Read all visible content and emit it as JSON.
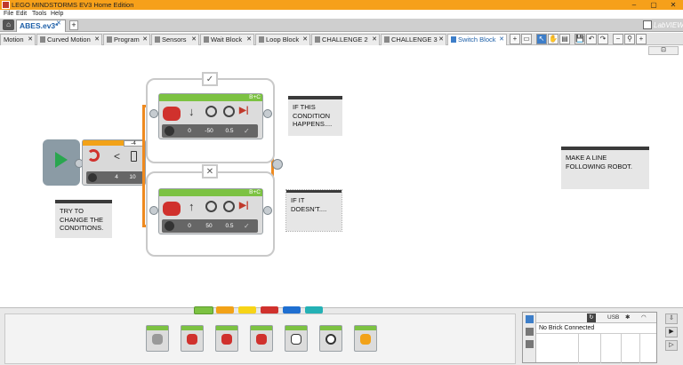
{
  "titlebar": {
    "title": "LEGO MINDSTORMS EV3 Home Edition",
    "minimize": "–",
    "maximize": "▢",
    "close": "✕"
  },
  "menubar": {
    "items": [
      "File",
      "Edit",
      "Tools",
      "Help"
    ]
  },
  "projectbar": {
    "home_icon": "⌂",
    "project_tab": "ABES.ev3*",
    "project_close": "✕",
    "add": "+",
    "labview": "LabVIEW"
  },
  "program_tabs": [
    {
      "label": "Motion"
    },
    {
      "label": "Curved Motion"
    },
    {
      "label": "Program"
    },
    {
      "label": "Sensors"
    },
    {
      "label": "Wait Block"
    },
    {
      "label": "Loop Block"
    },
    {
      "label": "CHALLENGE 2"
    },
    {
      "label": "CHALLENGE 3"
    },
    {
      "label": "Switch Block"
    }
  ],
  "tab_close": "✕",
  "toolbar": {
    "add_tab": "+",
    "doc": "▭",
    "select": "↖",
    "pan": "✋",
    "comment": "▤",
    "save": "💾",
    "undo": "↶",
    "redo": "↷",
    "zoom_out": "−",
    "zoom_fit": "⚲",
    "zoom_in": "+",
    "content": "⊡"
  },
  "comments": {
    "condition_true": "IF THIS\nCONDITION\nHAPPENS....",
    "condition_false": "IF IT\nDOESN'T....",
    "make_line": "MAKE A LINE\nFOLLOWING ROBOT.",
    "try_change": "TRY TO\nCHANGE THE\nCONDITIONS."
  },
  "switch_block": {
    "compare_value": "-4",
    "operator": "<",
    "mode_values": [
      "4",
      "10"
    ],
    "true_case_symbol": "✓",
    "false_case_symbol": "✕"
  },
  "motor_block_true": {
    "ports": "B+C",
    "arrow": "↓",
    "values": [
      "0",
      "-50",
      "0.5"
    ],
    "check": "✓"
  },
  "motor_block_false": {
    "ports": "B+C",
    "arrow": "↑",
    "values": [
      "0",
      "50",
      "0.5"
    ],
    "check": "✓"
  },
  "palette": {
    "category_colors": [
      "#7cc242",
      "#f2a218",
      "#f7d417",
      "#d0312d",
      "#1f6fd1",
      "#24b1b5"
    ],
    "block_count": 7
  },
  "hardware": {
    "status": "No Brick Connected",
    "usb": "USB",
    "bt": "✱",
    "wifi": "◠",
    "refresh": "↻"
  }
}
